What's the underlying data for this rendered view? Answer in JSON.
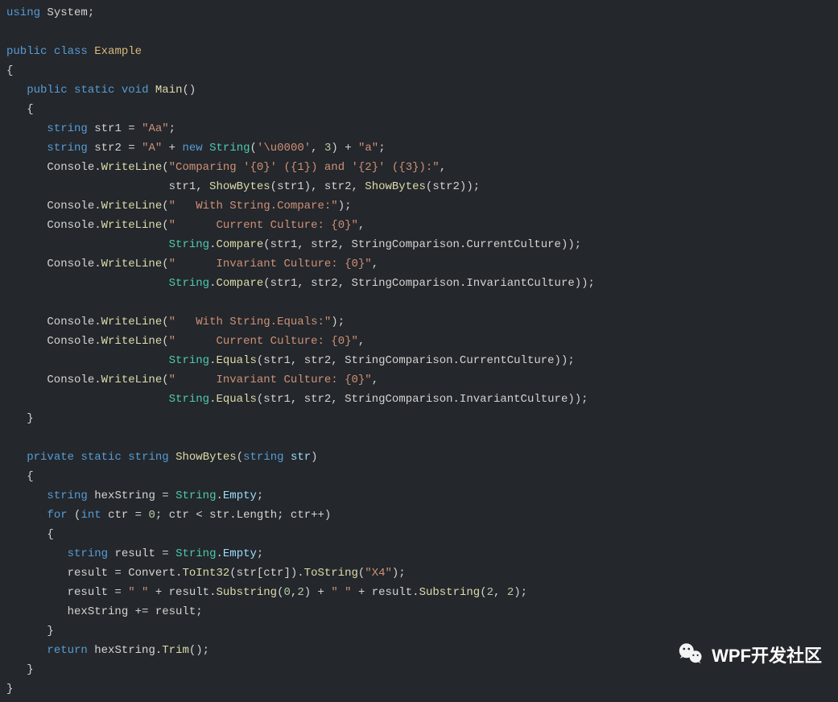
{
  "watermark": {
    "label": "WPF开发社区"
  },
  "code": {
    "l01": [
      {
        "c": "kw",
        "t": "using"
      },
      {
        "c": "txt",
        "t": " System;"
      }
    ],
    "l02": [
      {
        "c": "txt",
        "t": ""
      }
    ],
    "l03": [
      {
        "c": "kw",
        "t": "public"
      },
      {
        "c": "txt",
        "t": " "
      },
      {
        "c": "kw",
        "t": "class"
      },
      {
        "c": "txt",
        "t": " "
      },
      {
        "c": "cls",
        "t": "Example"
      }
    ],
    "l04": [
      {
        "c": "txt",
        "t": "{"
      }
    ],
    "l05": [
      {
        "c": "txt",
        "t": "   "
      },
      {
        "c": "kw",
        "t": "public"
      },
      {
        "c": "txt",
        "t": " "
      },
      {
        "c": "kw",
        "t": "static"
      },
      {
        "c": "txt",
        "t": " "
      },
      {
        "c": "kw",
        "t": "void"
      },
      {
        "c": "txt",
        "t": " "
      },
      {
        "c": "fn",
        "t": "Main"
      },
      {
        "c": "txt",
        "t": "()"
      }
    ],
    "l06": [
      {
        "c": "txt",
        "t": "   {"
      }
    ],
    "l07": [
      {
        "c": "txt",
        "t": "      "
      },
      {
        "c": "kw",
        "t": "string"
      },
      {
        "c": "txt",
        "t": " str1 = "
      },
      {
        "c": "str",
        "t": "\"Aa\""
      },
      {
        "c": "txt",
        "t": ";"
      }
    ],
    "l08": [
      {
        "c": "txt",
        "t": "      "
      },
      {
        "c": "kw",
        "t": "string"
      },
      {
        "c": "txt",
        "t": " str2 = "
      },
      {
        "c": "str",
        "t": "\"A\""
      },
      {
        "c": "txt",
        "t": " + "
      },
      {
        "c": "kw",
        "t": "new"
      },
      {
        "c": "txt",
        "t": " "
      },
      {
        "c": "tp",
        "t": "String"
      },
      {
        "c": "txt",
        "t": "("
      },
      {
        "c": "str",
        "t": "'\\u0000'"
      },
      {
        "c": "txt",
        "t": ", "
      },
      {
        "c": "num",
        "t": "3"
      },
      {
        "c": "txt",
        "t": ") + "
      },
      {
        "c": "str",
        "t": "\"a\""
      },
      {
        "c": "txt",
        "t": ";"
      }
    ],
    "l09": [
      {
        "c": "txt",
        "t": "      Console."
      },
      {
        "c": "fn",
        "t": "WriteLine"
      },
      {
        "c": "txt",
        "t": "("
      },
      {
        "c": "str",
        "t": "\"Comparing '{0}' ({1}) and '{2}' ({3}):\""
      },
      {
        "c": "txt",
        "t": ","
      }
    ],
    "l10": [
      {
        "c": "txt",
        "t": "                        str1, "
      },
      {
        "c": "fn",
        "t": "ShowBytes"
      },
      {
        "c": "txt",
        "t": "(str1), str2, "
      },
      {
        "c": "fn",
        "t": "ShowBytes"
      },
      {
        "c": "txt",
        "t": "(str2));"
      }
    ],
    "l11": [
      {
        "c": "txt",
        "t": "      Console."
      },
      {
        "c": "fn",
        "t": "WriteLine"
      },
      {
        "c": "txt",
        "t": "("
      },
      {
        "c": "str",
        "t": "\"   With String.Compare:\""
      },
      {
        "c": "txt",
        "t": ");"
      }
    ],
    "l12": [
      {
        "c": "txt",
        "t": "      Console."
      },
      {
        "c": "fn",
        "t": "WriteLine"
      },
      {
        "c": "txt",
        "t": "("
      },
      {
        "c": "str",
        "t": "\"      Current Culture: {0}\""
      },
      {
        "c": "txt",
        "t": ","
      }
    ],
    "l13": [
      {
        "c": "txt",
        "t": "                        "
      },
      {
        "c": "tp",
        "t": "String"
      },
      {
        "c": "txt",
        "t": "."
      },
      {
        "c": "fn",
        "t": "Compare"
      },
      {
        "c": "txt",
        "t": "(str1, str2, StringComparison.CurrentCulture));"
      }
    ],
    "l14": [
      {
        "c": "txt",
        "t": "      Console."
      },
      {
        "c": "fn",
        "t": "WriteLine"
      },
      {
        "c": "txt",
        "t": "("
      },
      {
        "c": "str",
        "t": "\"      Invariant Culture: {0}\""
      },
      {
        "c": "txt",
        "t": ","
      }
    ],
    "l15": [
      {
        "c": "txt",
        "t": "                        "
      },
      {
        "c": "tp",
        "t": "String"
      },
      {
        "c": "txt",
        "t": "."
      },
      {
        "c": "fn",
        "t": "Compare"
      },
      {
        "c": "txt",
        "t": "(str1, str2, StringComparison.InvariantCulture));"
      }
    ],
    "l16": [
      {
        "c": "txt",
        "t": ""
      }
    ],
    "l17": [
      {
        "c": "txt",
        "t": "      Console."
      },
      {
        "c": "fn",
        "t": "WriteLine"
      },
      {
        "c": "txt",
        "t": "("
      },
      {
        "c": "str",
        "t": "\"   With String.Equals:\""
      },
      {
        "c": "txt",
        "t": ");"
      }
    ],
    "l18": [
      {
        "c": "txt",
        "t": "      Console."
      },
      {
        "c": "fn",
        "t": "WriteLine"
      },
      {
        "c": "txt",
        "t": "("
      },
      {
        "c": "str",
        "t": "\"      Current Culture: {0}\""
      },
      {
        "c": "txt",
        "t": ","
      }
    ],
    "l19": [
      {
        "c": "txt",
        "t": "                        "
      },
      {
        "c": "tp",
        "t": "String"
      },
      {
        "c": "txt",
        "t": "."
      },
      {
        "c": "fn",
        "t": "Equals"
      },
      {
        "c": "txt",
        "t": "(str1, str2, StringComparison.CurrentCulture));"
      }
    ],
    "l20": [
      {
        "c": "txt",
        "t": "      Console."
      },
      {
        "c": "fn",
        "t": "WriteLine"
      },
      {
        "c": "txt",
        "t": "("
      },
      {
        "c": "str",
        "t": "\"      Invariant Culture: {0}\""
      },
      {
        "c": "txt",
        "t": ","
      }
    ],
    "l21": [
      {
        "c": "txt",
        "t": "                        "
      },
      {
        "c": "tp",
        "t": "String"
      },
      {
        "c": "txt",
        "t": "."
      },
      {
        "c": "fn",
        "t": "Equals"
      },
      {
        "c": "txt",
        "t": "(str1, str2, StringComparison.InvariantCulture));"
      }
    ],
    "l22": [
      {
        "c": "txt",
        "t": "   }"
      }
    ],
    "l23": [
      {
        "c": "txt",
        "t": ""
      }
    ],
    "l24": [
      {
        "c": "txt",
        "t": "   "
      },
      {
        "c": "kw",
        "t": "private"
      },
      {
        "c": "txt",
        "t": " "
      },
      {
        "c": "kw",
        "t": "static"
      },
      {
        "c": "txt",
        "t": " "
      },
      {
        "c": "kw",
        "t": "string"
      },
      {
        "c": "txt",
        "t": " "
      },
      {
        "c": "fn",
        "t": "ShowBytes"
      },
      {
        "c": "txt",
        "t": "("
      },
      {
        "c": "kw",
        "t": "string"
      },
      {
        "c": "txt",
        "t": " "
      },
      {
        "c": "var",
        "t": "str"
      },
      {
        "c": "txt",
        "t": ")"
      }
    ],
    "l25": [
      {
        "c": "txt",
        "t": "   {"
      }
    ],
    "l26": [
      {
        "c": "txt",
        "t": "      "
      },
      {
        "c": "kw",
        "t": "string"
      },
      {
        "c": "txt",
        "t": " hexString = "
      },
      {
        "c": "tp",
        "t": "String"
      },
      {
        "c": "txt",
        "t": "."
      },
      {
        "c": "var",
        "t": "Empty"
      },
      {
        "c": "txt",
        "t": ";"
      }
    ],
    "l27": [
      {
        "c": "txt",
        "t": "      "
      },
      {
        "c": "kw",
        "t": "for"
      },
      {
        "c": "txt",
        "t": " ("
      },
      {
        "c": "kw",
        "t": "int"
      },
      {
        "c": "txt",
        "t": " ctr = "
      },
      {
        "c": "num",
        "t": "0"
      },
      {
        "c": "txt",
        "t": "; ctr < str.Length; ctr++)"
      }
    ],
    "l28": [
      {
        "c": "txt",
        "t": "      {"
      }
    ],
    "l29": [
      {
        "c": "txt",
        "t": "         "
      },
      {
        "c": "kw",
        "t": "string"
      },
      {
        "c": "txt",
        "t": " result = "
      },
      {
        "c": "tp",
        "t": "String"
      },
      {
        "c": "txt",
        "t": "."
      },
      {
        "c": "var",
        "t": "Empty"
      },
      {
        "c": "txt",
        "t": ";"
      }
    ],
    "l30": [
      {
        "c": "txt",
        "t": "         result = Convert."
      },
      {
        "c": "fn",
        "t": "ToInt32"
      },
      {
        "c": "txt",
        "t": "(str[ctr])."
      },
      {
        "c": "fn",
        "t": "ToString"
      },
      {
        "c": "txt",
        "t": "("
      },
      {
        "c": "str",
        "t": "\"X4\""
      },
      {
        "c": "txt",
        "t": ");"
      }
    ],
    "l31": [
      {
        "c": "txt",
        "t": "         result = "
      },
      {
        "c": "str",
        "t": "\" \""
      },
      {
        "c": "txt",
        "t": " + result."
      },
      {
        "c": "fn",
        "t": "Substring"
      },
      {
        "c": "txt",
        "t": "("
      },
      {
        "c": "num",
        "t": "0"
      },
      {
        "c": "txt",
        "t": ","
      },
      {
        "c": "num",
        "t": "2"
      },
      {
        "c": "txt",
        "t": ") + "
      },
      {
        "c": "str",
        "t": "\" \""
      },
      {
        "c": "txt",
        "t": " + result."
      },
      {
        "c": "fn",
        "t": "Substring"
      },
      {
        "c": "txt",
        "t": "("
      },
      {
        "c": "num",
        "t": "2"
      },
      {
        "c": "txt",
        "t": ", "
      },
      {
        "c": "num",
        "t": "2"
      },
      {
        "c": "txt",
        "t": ");"
      }
    ],
    "l32": [
      {
        "c": "txt",
        "t": "         hexString += result;"
      }
    ],
    "l33": [
      {
        "c": "txt",
        "t": "      }"
      }
    ],
    "l34": [
      {
        "c": "txt",
        "t": "      "
      },
      {
        "c": "kw",
        "t": "return"
      },
      {
        "c": "txt",
        "t": " hexString."
      },
      {
        "c": "fn",
        "t": "Trim"
      },
      {
        "c": "txt",
        "t": "();"
      }
    ],
    "l35": [
      {
        "c": "txt",
        "t": "   }"
      }
    ],
    "l36": [
      {
        "c": "txt",
        "t": "}"
      }
    ]
  },
  "lineOrder": [
    "l01",
    "l02",
    "l03",
    "l04",
    "l05",
    "l06",
    "l07",
    "l08",
    "l09",
    "l10",
    "l11",
    "l12",
    "l13",
    "l14",
    "l15",
    "l16",
    "l17",
    "l18",
    "l19",
    "l20",
    "l21",
    "l22",
    "l23",
    "l24",
    "l25",
    "l26",
    "l27",
    "l28",
    "l29",
    "l30",
    "l31",
    "l32",
    "l33",
    "l34",
    "l35",
    "l36"
  ]
}
